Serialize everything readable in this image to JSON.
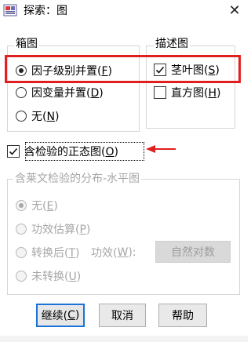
{
  "window": {
    "title": "探索：图"
  },
  "boxplot_group": {
    "title": "箱图",
    "options": [
      {
        "label": "因子级别并置(",
        "key": "F",
        "suffix": ")",
        "checked": true
      },
      {
        "label": "因变量并置(",
        "key": "D",
        "suffix": ")",
        "checked": false
      },
      {
        "label": "无(",
        "key": "N",
        "suffix": ")",
        "checked": false
      }
    ]
  },
  "descriptive_group": {
    "title": "描述图",
    "options": [
      {
        "label": "茎叶图(",
        "key": "S",
        "suffix": ")",
        "checked": true
      },
      {
        "label": "直方图(",
        "key": "H",
        "suffix": ")",
        "checked": false
      }
    ]
  },
  "normality": {
    "label": "含检验的正态图(",
    "key": "O",
    "suffix": ")",
    "checked": true
  },
  "levene_group": {
    "title": "含莱文检验的分布-水平图",
    "options": [
      {
        "label": "无(",
        "key": "E",
        "suffix": ")"
      },
      {
        "label": "功效估算(",
        "key": "P",
        "suffix": ")"
      },
      {
        "label": "转换后(",
        "key": "T",
        "suffix": ")"
      },
      {
        "label": "未转换(",
        "key": "U",
        "suffix": ")"
      }
    ],
    "power_label": "功效(",
    "power_key": "W",
    "power_suffix": "):",
    "power_value": "自然对数"
  },
  "buttons": {
    "continue": {
      "label": "继续(",
      "key": "C",
      "suffix": ")"
    },
    "cancel": "取消",
    "help": "帮助"
  },
  "colors": {
    "highlight_red": "#e02020",
    "default_button_blue": "#1a73d9"
  }
}
